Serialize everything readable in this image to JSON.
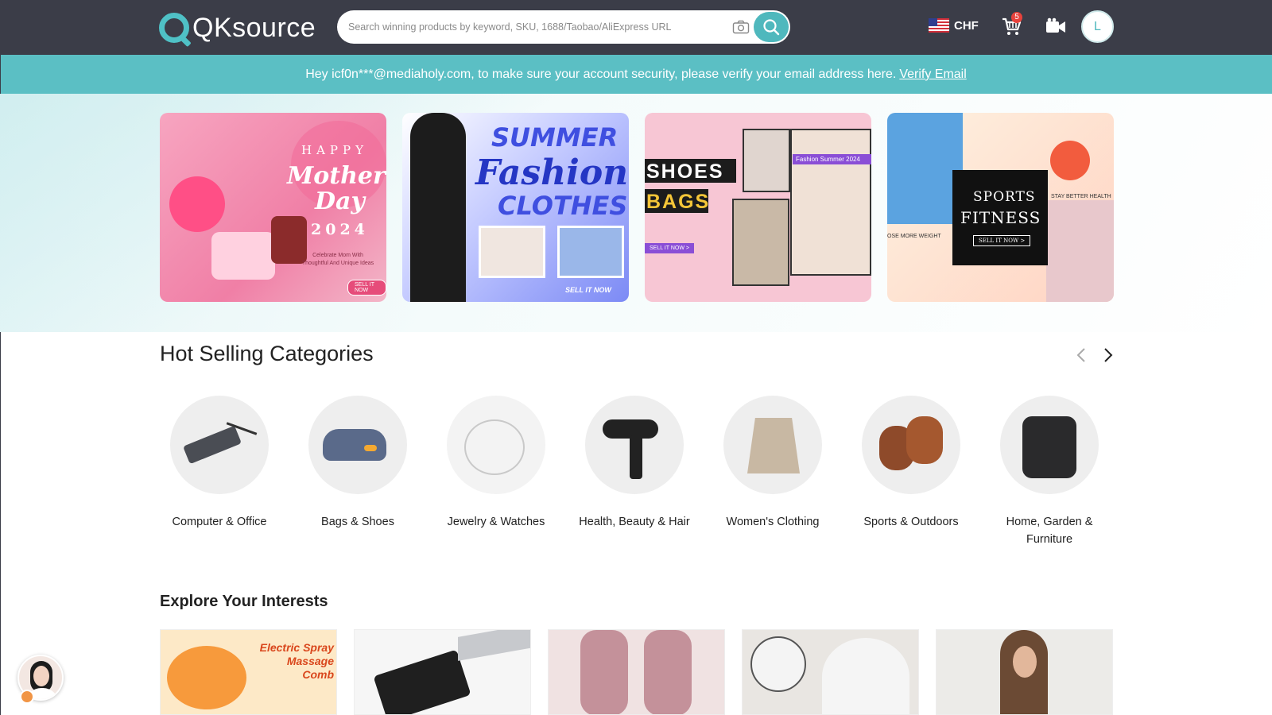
{
  "header": {
    "logo_text": "QKsource",
    "search_placeholder": "Search winning products by keyword, SKU, 1688/Taobao/AliExpress URL",
    "currency": "CHF",
    "cart_count": "5",
    "avatar_initial": "L"
  },
  "notice": {
    "message": "Hey icf0n***@mediaholy.com, to make sure your account security, please verify your email address here.",
    "link": "Verify Email"
  },
  "banners": [
    {
      "line1": "HAPPY",
      "line2": "Mother's",
      "line3": "Day",
      "year": "2024",
      "sub": "Celebrate Mom With Thoughtful And Unique Ideas",
      "cta": "SELL IT NOW"
    },
    {
      "line1": "SUMMER",
      "line2": "Fashion",
      "line3": "CLOTHES",
      "cta": "SELL IT NOW"
    },
    {
      "line1": "SHOES",
      "line2": "BAGS",
      "tag": "Fashion Summer 2024",
      "cta": "SELL IT NOW >"
    },
    {
      "line1": "SPORTS",
      "line2": "FITNESS",
      "cta": "SELL IT NOW >",
      "left_tag": "OSE MORE WEIGHT",
      "right_tag": "STAY BETTER HEALTH"
    }
  ],
  "hot_selling": {
    "title": "Hot Selling Categories",
    "categories": [
      {
        "label": "Computer & Office"
      },
      {
        "label": "Bags & Shoes"
      },
      {
        "label": "Jewelry & Watches"
      },
      {
        "label": "Health, Beauty & Hair"
      },
      {
        "label": "Women's Clothing"
      },
      {
        "label": "Sports & Outdoors"
      },
      {
        "label": "Home, Garden & Furniture"
      }
    ]
  },
  "explore": {
    "title": "Explore Your Interests",
    "tile1_text": "Electric Spray Massage Comb"
  },
  "colors": {
    "header_bg": "#3b3d48",
    "accent": "#5bbfc4",
    "badge": "#e8423c"
  }
}
